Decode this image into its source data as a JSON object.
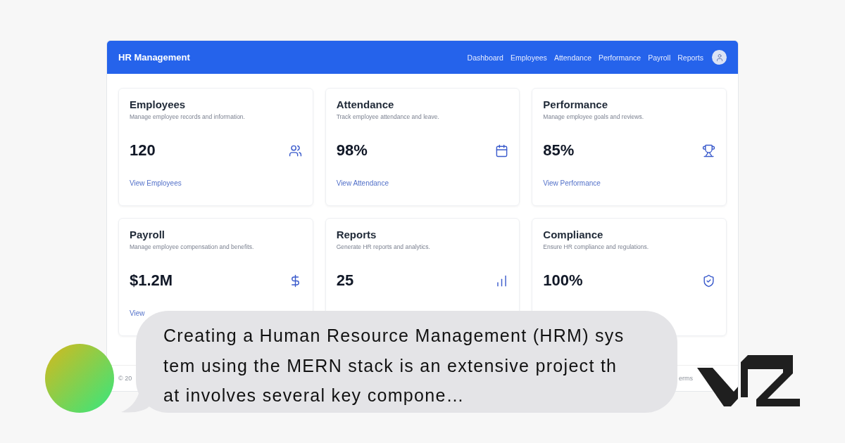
{
  "app": {
    "title": "HR Management",
    "nav": [
      "Dashboard",
      "Employees",
      "Attendance",
      "Performance",
      "Payroll",
      "Reports"
    ],
    "cards": [
      {
        "title": "Employees",
        "description": "Manage employee records and information.",
        "value": "120",
        "link": "View Employees"
      },
      {
        "title": "Attendance",
        "description": "Track employee attendance and leave.",
        "value": "98%",
        "link": "View Attendance"
      },
      {
        "title": "Performance",
        "description": "Manage employee goals and reviews.",
        "value": "85%",
        "link": "View Performance"
      },
      {
        "title": "Payroll",
        "description": "Manage employee compensation and benefits.",
        "value": "$1.2M",
        "link": "View"
      },
      {
        "title": "Reports",
        "description": "Generate HR reports and analytics.",
        "value": "25"
      },
      {
        "title": "Compliance",
        "description": "Ensure HR compliance and regulations.",
        "value": "100%"
      }
    ],
    "footer": {
      "copyright": "© 20",
      "links": [
        "erms"
      ]
    }
  },
  "chat_bubble": {
    "lines": [
      "Creating a Human Resource Management (HRM) sys",
      "tem using the MERN stack is an extensive project th",
      "at involves several key compone…"
    ]
  }
}
